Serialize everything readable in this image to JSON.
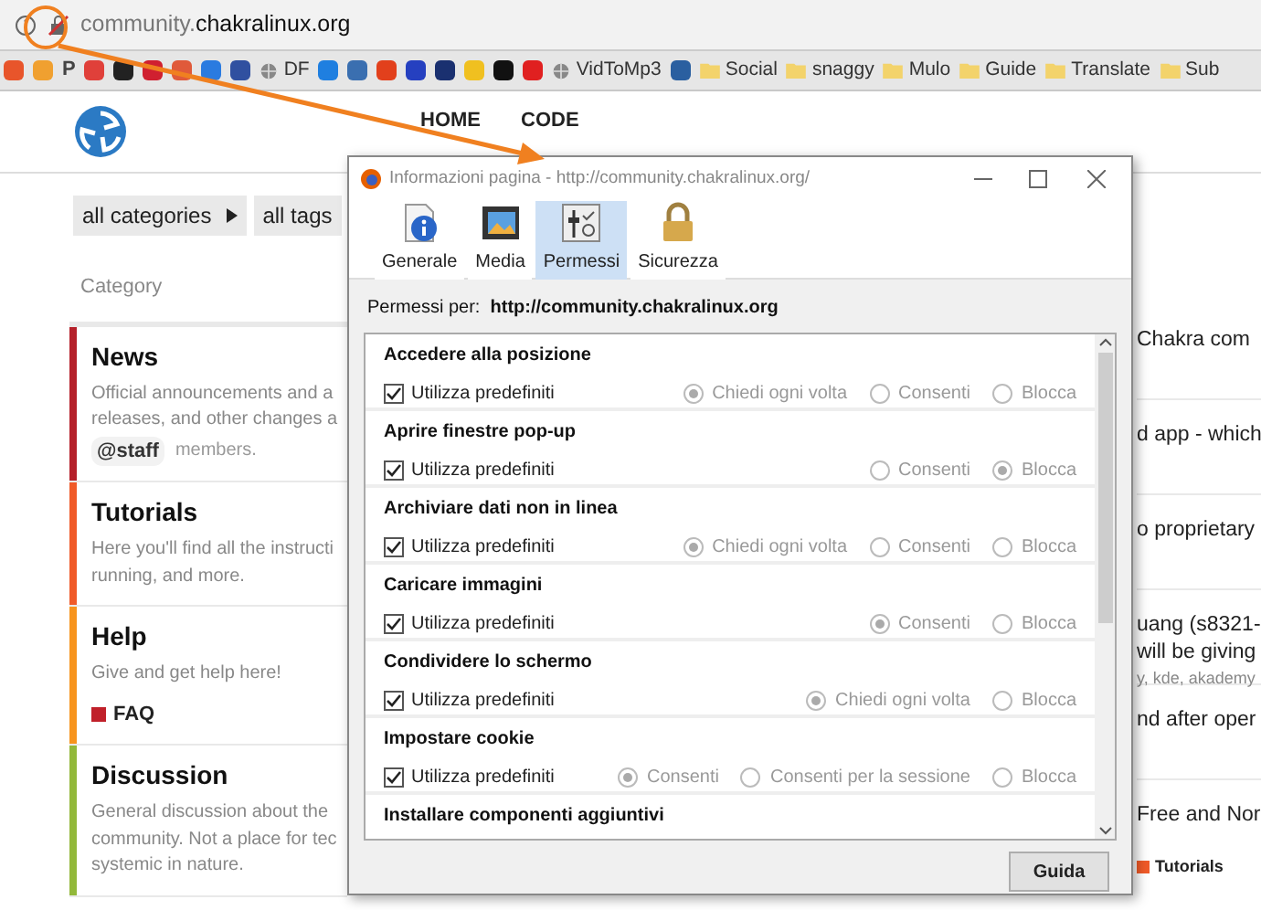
{
  "browser": {
    "address": {
      "subdomain": "community.",
      "domain": "chakralinux.org"
    },
    "bookmarks": [
      {
        "kind": "icon",
        "color": "#e8552b"
      },
      {
        "kind": "icon",
        "color": "#f0a030"
      },
      {
        "kind": "letter",
        "label": "P"
      },
      {
        "kind": "icon",
        "color": "#e0403a"
      },
      {
        "kind": "icon",
        "color": "#222222"
      },
      {
        "kind": "icon",
        "color": "#d02030"
      },
      {
        "kind": "icon",
        "color": "#e05a3a"
      },
      {
        "kind": "icon",
        "color": "#2a7be0"
      },
      {
        "kind": "icon",
        "color": "#3050a0"
      },
      {
        "kind": "globe",
        "label": "DF"
      },
      {
        "kind": "icon",
        "color": "#1f7fe0"
      },
      {
        "kind": "icon",
        "color": "#3a6fb0"
      },
      {
        "kind": "icon",
        "color": "#e2401c"
      },
      {
        "kind": "icon",
        "color": "#2540c0"
      },
      {
        "kind": "icon",
        "color": "#1a3070"
      },
      {
        "kind": "icon",
        "color": "#f0c020"
      },
      {
        "kind": "icon",
        "color": "#111111"
      },
      {
        "kind": "icon",
        "color": "#e02020"
      },
      {
        "kind": "globe",
        "label": "VidToMp3"
      },
      {
        "kind": "icon",
        "color": "#2a5fa0"
      },
      {
        "kind": "folder",
        "label": "Social"
      },
      {
        "kind": "folder",
        "label": "snaggy"
      },
      {
        "kind": "folder",
        "label": "Mulo"
      },
      {
        "kind": "folder",
        "label": "Guide"
      },
      {
        "kind": "folder",
        "label": "Translate"
      },
      {
        "kind": "folder",
        "label": "Sub"
      }
    ]
  },
  "site": {
    "nav": [
      "HOME",
      "CODE"
    ],
    "filters": [
      {
        "label": "all categories",
        "caret": true
      },
      {
        "label": "all tags",
        "caret": false
      }
    ],
    "category_heading": "Category",
    "categories": [
      {
        "name": "News",
        "color": "#b5202a",
        "description": [
          "Official announcements and a",
          "releases, and other changes a"
        ],
        "mention": "@staff",
        "mention_suffix": "members."
      },
      {
        "name": "Tutorials",
        "color": "#f05a28",
        "description": [
          "Here you'll find all the instructi",
          "running, and more."
        ]
      },
      {
        "name": "Help",
        "color": "#f7941d",
        "description": [
          "Give and get help here!"
        ],
        "subcategory": {
          "name": "FAQ",
          "color": "#c0202a"
        }
      },
      {
        "name": "Discussion",
        "color": "#92b83a",
        "description": [
          "General discussion about the",
          "community. Not a place for tec",
          "systemic in nature."
        ]
      }
    ],
    "latest": [
      {
        "lines": [
          "Chakra com"
        ]
      },
      {
        "lines": [
          "d app - which"
        ]
      },
      {
        "lines": [
          "o proprietary"
        ]
      },
      {
        "lines": [
          "uang (s8321-",
          "will be giving"
        ],
        "tags": "y, kde, akademy"
      },
      {
        "lines": [
          "nd after oper"
        ]
      },
      {
        "lines": [
          "Free and Nor"
        ],
        "category": {
          "name": "Tutorials",
          "color": "#f05a28"
        }
      }
    ]
  },
  "dialog": {
    "title": "Informazioni pagina - http://community.chakralinux.org/",
    "tabs": [
      {
        "label": "Generale",
        "kind": "info",
        "selected": false
      },
      {
        "label": "Media",
        "kind": "media",
        "selected": false
      },
      {
        "label": "Permessi",
        "kind": "permissions",
        "selected": true
      },
      {
        "label": "Sicurezza",
        "kind": "security",
        "selected": false
      }
    ],
    "permissions_for": "Permessi per:  **http://community.chakralinux.org**",
    "permissions": [
      {
        "title": "Accedere alla posizione",
        "default": {
          "label": "Utilizza predefiniti",
          "checked": true
        },
        "disabled": true,
        "options": [
          {
            "label": "Chiedi ogni volta",
            "selected": true
          },
          {
            "label": "Consenti",
            "selected": false
          },
          {
            "label": "Blocca",
            "selected": false
          }
        ]
      },
      {
        "title": "Aprire finestre pop-up",
        "default": {
          "label": "Utilizza predefiniti",
          "checked": true
        },
        "disabled": true,
        "options": [
          {
            "label": "Consenti",
            "selected": false
          },
          {
            "label": "Blocca",
            "selected": true
          }
        ]
      },
      {
        "title": "Archiviare dati non in linea",
        "default": {
          "label": "Utilizza predefiniti",
          "checked": true
        },
        "disabled": true,
        "options": [
          {
            "label": "Chiedi ogni volta",
            "selected": true
          },
          {
            "label": "Consenti",
            "selected": false
          },
          {
            "label": "Blocca",
            "selected": false
          }
        ]
      },
      {
        "title": "Caricare immagini",
        "default": {
          "label": "Utilizza predefiniti",
          "checked": true
        },
        "disabled": true,
        "options": [
          {
            "label": "Consenti",
            "selected": true
          },
          {
            "label": "Blocca",
            "selected": false
          }
        ]
      },
      {
        "title": "Condividere lo schermo",
        "default": {
          "label": "Utilizza predefiniti",
          "checked": true
        },
        "disabled": true,
        "options": [
          {
            "label": "Chiedi ogni volta",
            "selected": true
          },
          {
            "label": "Blocca",
            "selected": false
          }
        ]
      },
      {
        "title": "Impostare cookie",
        "default": {
          "label": "Utilizza predefiniti",
          "checked": true
        },
        "disabled": true,
        "options": [
          {
            "label": "Consenti",
            "selected": true
          },
          {
            "label": "Consenti per la sessione",
            "selected": false
          },
          {
            "label": "Blocca",
            "selected": false
          }
        ]
      },
      {
        "title": "Installare componenti aggiuntivi"
      }
    ],
    "help_button": "Guida"
  }
}
